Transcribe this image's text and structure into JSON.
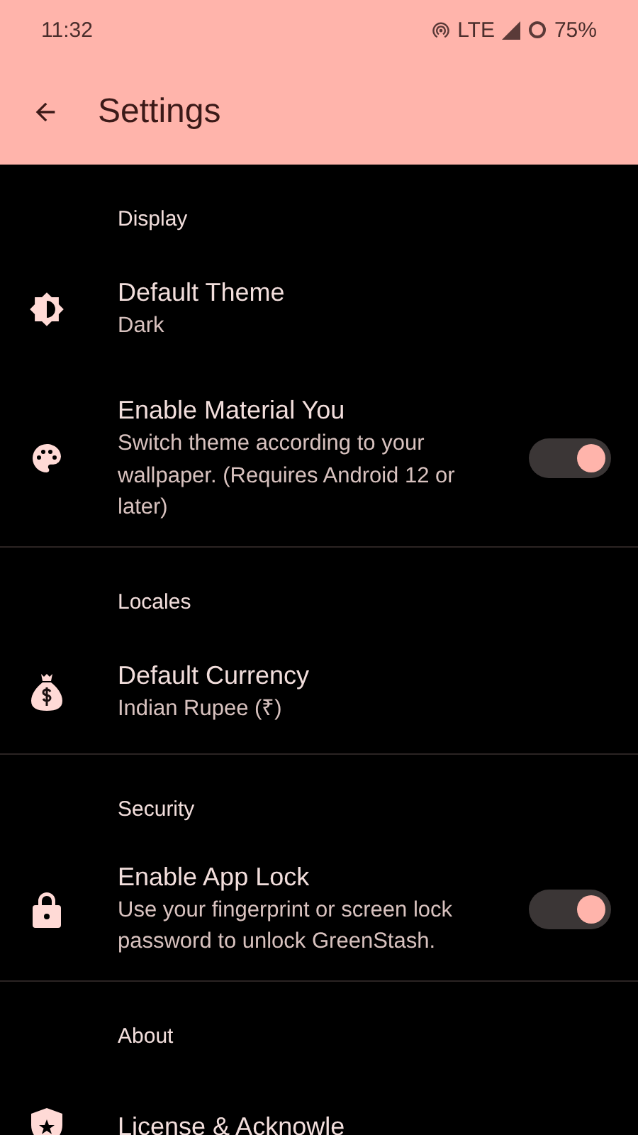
{
  "status_bar": {
    "time": "11:32",
    "network": "LTE",
    "battery": "75%"
  },
  "toolbar": {
    "title": "Settings"
  },
  "sections": [
    {
      "header": "Display",
      "items": [
        {
          "kind": "value",
          "title": "Default Theme",
          "subtitle": "Dark"
        },
        {
          "kind": "switch",
          "title": "Enable Material You",
          "subtitle": "Switch theme according to your wallpaper. (Requires Android 12 or later)",
          "on": true
        }
      ]
    },
    {
      "header": "Locales",
      "items": [
        {
          "kind": "value",
          "title": "Default Currency",
          "subtitle": "Indian Rupee (₹)"
        }
      ]
    },
    {
      "header": "Security",
      "items": [
        {
          "kind": "switch",
          "title": "Enable App Lock",
          "subtitle": "Use your fingerprint or screen lock password to unlock GreenStash.",
          "on": true
        }
      ]
    },
    {
      "header": "About",
      "items": [
        {
          "kind": "value",
          "title": "License & Acknowle"
        }
      ]
    }
  ]
}
